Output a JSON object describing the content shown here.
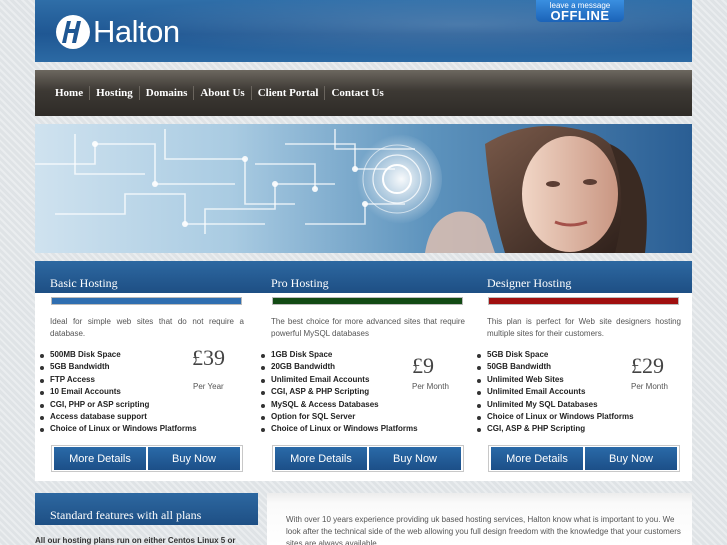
{
  "header": {
    "logo_text": "Halton",
    "status_small": "leave a message",
    "status_big": "OFFLINE"
  },
  "nav": {
    "items": [
      "Home",
      "Hosting",
      "Domains",
      "About Us",
      "Client Portal",
      "Contact Us"
    ]
  },
  "plans": [
    {
      "title": "Basic Hosting",
      "bar_color": "#2f6eb0",
      "description": "Ideal for simple web sites that do not require a database.",
      "price": "£39",
      "period": "Per Year",
      "features": [
        "500MB Disk Space",
        "5GB Bandwidth",
        "FTP Access",
        "10 Email Accounts",
        "CGI, PHP or ASP scripting",
        "Access database support",
        "Choice of Linux or Windows Platforms"
      ],
      "more_label": "More Details",
      "buy_label": "Buy Now"
    },
    {
      "title": "Pro Hosting",
      "bar_color": "#124a14",
      "description": "The best choice for more advanced sites that require powerful MySQL databases",
      "price": "£9",
      "period": "Per Month",
      "features": [
        "1GB Disk Space",
        "20GB Bandwidth",
        "Unlimited Email Accounts",
        "CGI, ASP & PHP Scripting",
        "MySQL & Access Databases",
        "Option for SQL Server",
        "Choice of Linux or Windows Platforms"
      ],
      "more_label": "More Details",
      "buy_label": "Buy Now"
    },
    {
      "title": "Designer Hosting",
      "bar_color": "#a00f0f",
      "description": "This plan is perfect for Web site designers hosting multiple sites for their customers.",
      "price": "£29",
      "period": "Per Month",
      "features": [
        "5GB Disk Space",
        "50GB Bandwidth",
        "Unlimited Web Sites",
        "Unlimited Email Accounts",
        "Unlimited My SQL Databases",
        "Choice of Linux or Windows Platforms",
        "CGI, ASP & PHP Scripting"
      ],
      "more_label": "More Details",
      "buy_label": "Buy Now"
    }
  ],
  "standard": {
    "title": "Standard features with all plans",
    "text": "All our hosting plans run on either Centos Linux 5 or"
  },
  "about": {
    "text": "With over 10 years experience providing uk based hosting services, Halton know what is important to you. We look after the technical side of the web allowing you full design freedom with the knowledge that your customers sites are always available."
  },
  "colors": {
    "header_blue": "#1f5793",
    "nav_dark": "#2e2b27",
    "button_blue": "#1c4f88"
  }
}
